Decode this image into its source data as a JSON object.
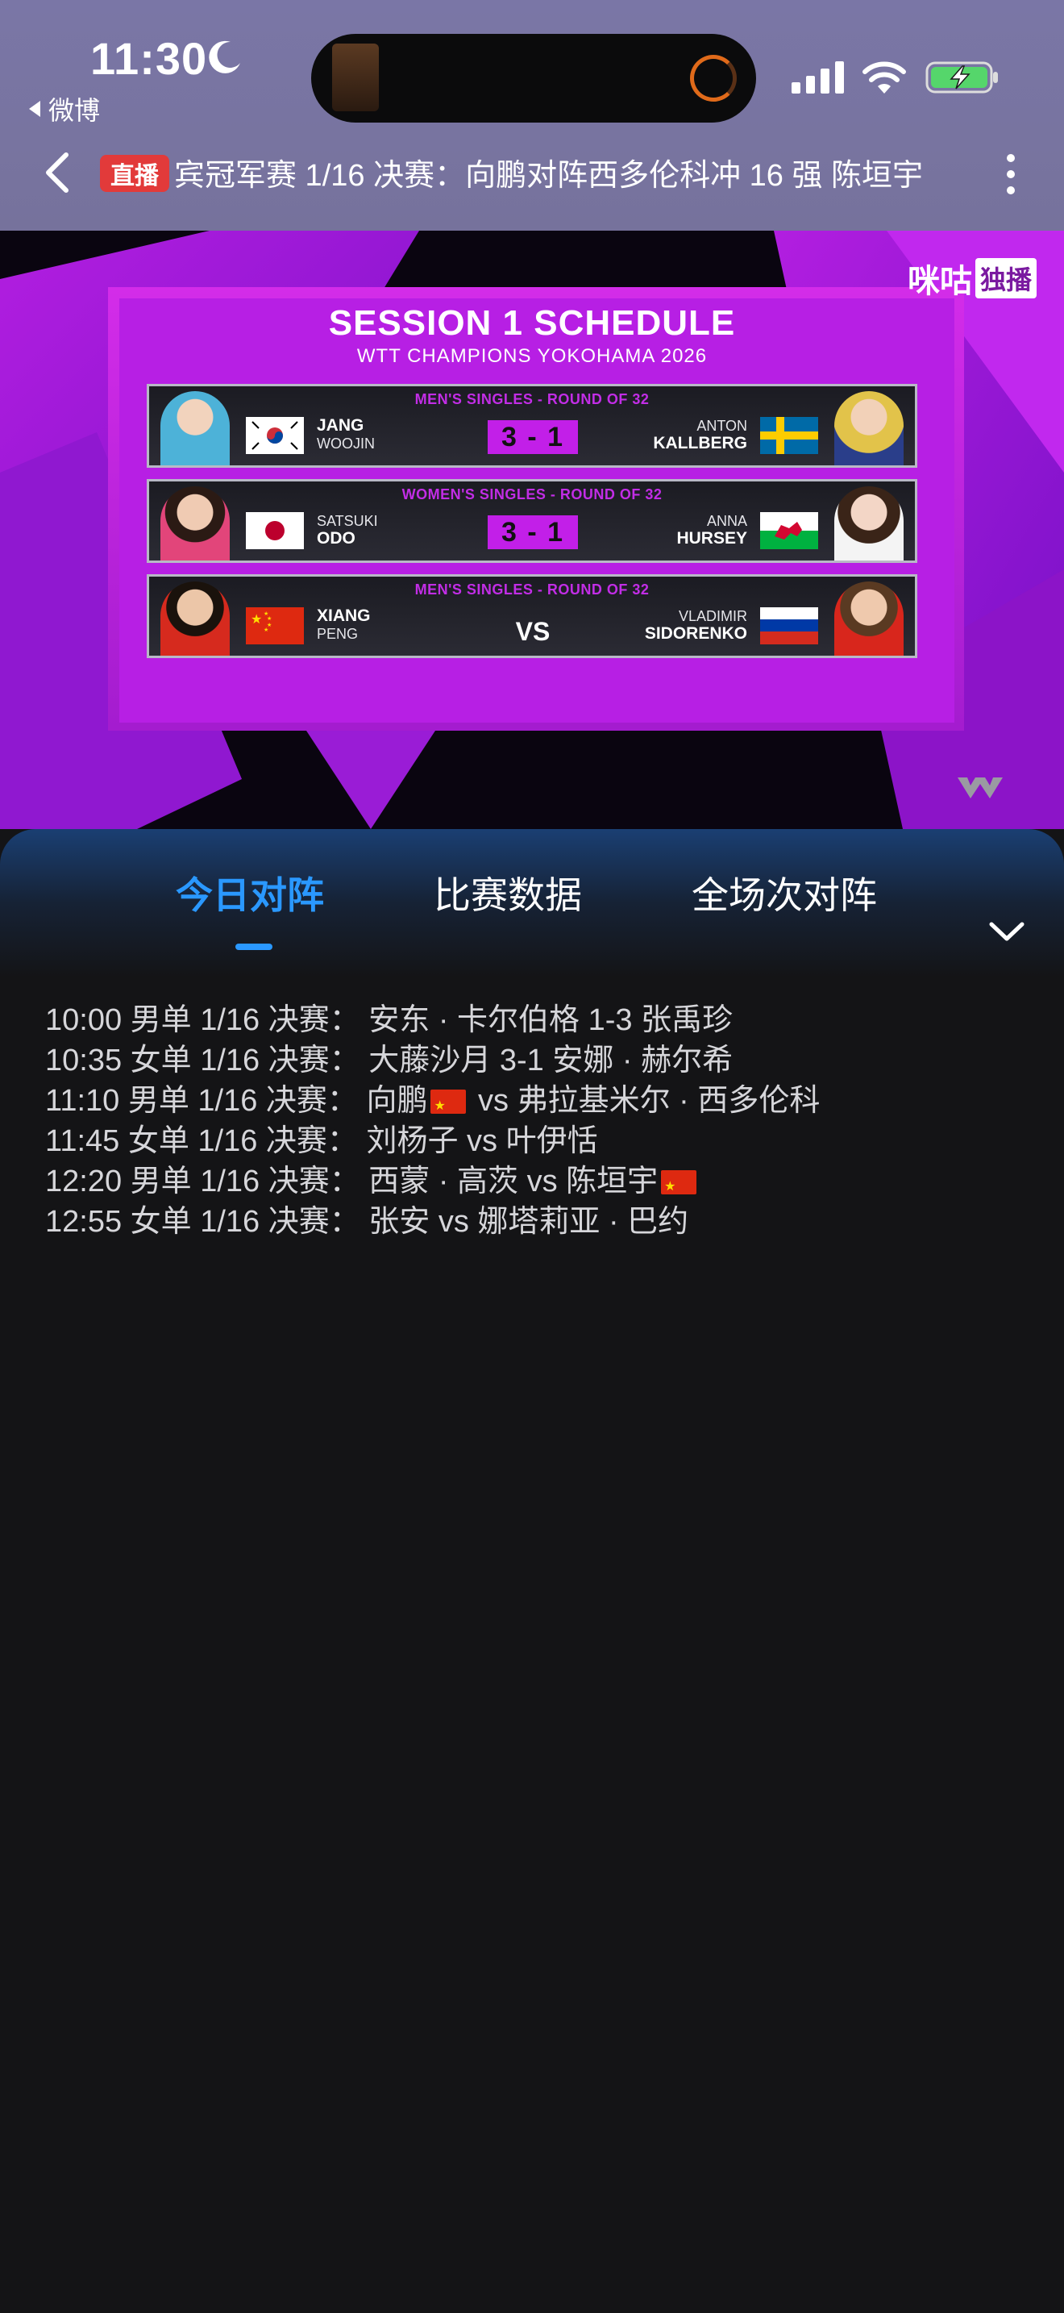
{
  "status_bar": {
    "time": "11:30",
    "back_app_label": "微博"
  },
  "nav": {
    "live_badge": "直播",
    "title": "宾冠军赛 1/16 决赛：向鹏对阵西多伦科冲 16 强 陈垣宇"
  },
  "video": {
    "watermark": "咪咕",
    "watermark_tag": "独播",
    "title": "SESSION 1 SCHEDULE",
    "subtitle": "WTT CHAMPIONS YOKOHAMA 2026",
    "matches": [
      {
        "round": "MEN'S SINGLES - ROUND OF 32",
        "left_first": "JANG",
        "left_last": "WOOJIN",
        "right_first": "ANTON",
        "right_last": "KALLBERG",
        "score": "3 - 1"
      },
      {
        "round": "WOMEN'S SINGLES - ROUND OF 32",
        "left_first": "SATSUKI",
        "left_last": "ODO",
        "right_first": "ANNA",
        "right_last": "HURSEY",
        "score": "3 - 1"
      },
      {
        "round": "MEN'S SINGLES - ROUND OF 32",
        "left_first": "XIANG",
        "left_last": "PENG",
        "right_first": "VLADIMIR",
        "right_last": "SIDORENKO",
        "score": "VS"
      }
    ]
  },
  "tabs": [
    "今日对阵",
    "比赛数据",
    "全场次对阵"
  ],
  "schedule": [
    {
      "text": "10:00 男单 1/16 决赛：  安东 · 卡尔伯格 1-3 张禹珍"
    },
    {
      "text": "10:35 女单 1/16 决赛：  大藤沙月 3-1 安娜 · 赫尔希"
    },
    {
      "a": "11:10 男单 1/16 决赛：  向鹏",
      "b": " vs 弗拉基米尔 · 西多伦科"
    },
    {
      "text": "11:45 女单 1/16 决赛：  刘杨子 vs 叶伊恬"
    },
    {
      "a": "12:20 男单 1/16 决赛：  西蒙 · 高茨 vs 陈垣宇",
      "b": ""
    },
    {
      "text": "12:55 女单 1/16 决赛：  张安 vs 娜塔莉亚 · 巴约"
    }
  ]
}
